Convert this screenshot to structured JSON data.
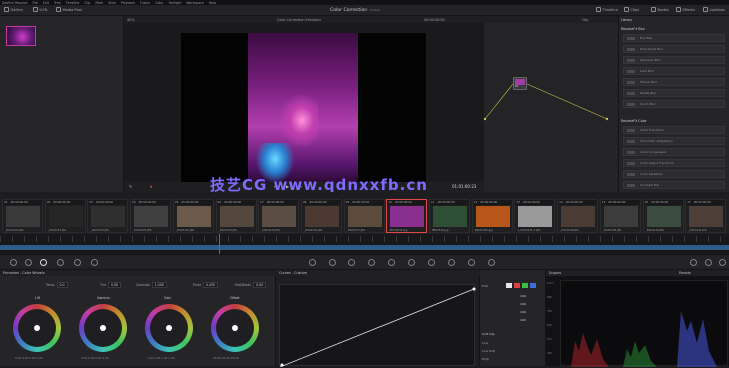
{
  "menubar": [
    "DaVinci Resolve",
    "File",
    "Edit",
    "Trim",
    "Timeline",
    "Clip",
    "Mark",
    "View",
    "Playback",
    "Fusion",
    "Color",
    "Fairlight",
    "Workspace",
    "Help"
  ],
  "toolbar": {
    "gallery": "Gallery",
    "luts": "LUTs",
    "media_pool": "Media Pool",
    "title": "Color Correction",
    "title_suffix": "Edited",
    "timeline": "Timeline",
    "clips": "Clips",
    "nodes": "Nodes",
    "effects": "Effects",
    "lightbox": "Lightbox"
  },
  "viewer": {
    "zoom": "40%",
    "timeline_name": "Color Correction Emulator",
    "timecode_top": "00:00:00:00",
    "timecode": "01:01:00:23",
    "watermark": "技艺CG www.qdnxxfb.cn"
  },
  "nodes": {
    "mode": "Clip",
    "node_label": "01"
  },
  "library": {
    "tab": "Library",
    "section1": "ResolveFX Blur",
    "blur_items": [
      "Box Blur",
      "Directional Blur",
      "Gaussian Blur",
      "Lens Blur",
      "Mosaic Blur",
      "Radial Blur",
      "Zoom Blur"
    ],
    "section2": "ResolveFX Color",
    "color_items": [
      "ACES Transform",
      "Chromatic Adaptation",
      "Color Compressor",
      "Color Space Transform",
      "Color Stabilizer",
      "Contrast Pop"
    ]
  },
  "clip_strip": [
    {
      "num": "01",
      "tc": "00:00:00:00",
      "name": "_DSC0122.JPG",
      "img": "#3a3a3a"
    },
    {
      "num": "02",
      "tc": "00:00:00:00",
      "name": "_DSC0123.JPG",
      "img": "#262626"
    },
    {
      "num": "03",
      "tc": "00:00:00:00",
      "name": "_DSC0124.JPG",
      "img": "#2f2f2f"
    },
    {
      "num": "04",
      "tc": "00:00:00:00",
      "name": "_DSC0125.JPG",
      "img": "#404040"
    },
    {
      "num": "05",
      "tc": "00:00:00:00",
      "name": "_DSC0131.JPG",
      "img": "#6b5a4a"
    },
    {
      "num": "06",
      "tc": "00:00:00:00",
      "name": "_DSC0132.JPG",
      "img": "#54483c"
    },
    {
      "num": "07",
      "tc": "00:00:00:00",
      "name": "_DSC0133.JPG",
      "img": "#5a4e42"
    },
    {
      "num": "08",
      "tc": "00:00:00:00",
      "name": "_DSC0134.JPG",
      "img": "#4b3a32"
    },
    {
      "num": "09",
      "tc": "00:00:00:00",
      "name": "_DSC0137.JPG",
      "img": "#5a4b3a"
    },
    {
      "num": "10",
      "tc": "00:00:00:00",
      "name": "06722097.jpg",
      "img": "#8a2f8d"
    },
    {
      "num": "11",
      "tc": "00:00:00:00",
      "name": "8802345.jpg",
      "img": "#2e4f34"
    },
    {
      "num": "12",
      "tc": "00:00:00:00",
      "name": "06072745.jpg",
      "img": "#b8561a"
    },
    {
      "num": "13",
      "tc": "00:00:00:00",
      "name": "1_DSC0125_1.JPG",
      "img": "#9a9a9a"
    },
    {
      "num": "14",
      "tc": "00:00:00:00",
      "name": "_DSC0138.JPG",
      "img": "#4a3c35"
    },
    {
      "num": "15",
      "tc": "00:00:00:00",
      "name": "_DSC0139.JPG",
      "img": "#3c3c3c"
    },
    {
      "num": "16",
      "tc": "00:00:00:00",
      "name": "_DSC0140.JPG",
      "img": "#3a4c3e"
    },
    {
      "num": "17",
      "tc": "00:00:00:00",
      "name": "_DSC0141.JPG",
      "img": "#4e3e38"
    }
  ],
  "wheels_panel": {
    "title": "Primaries - Color Wheels",
    "temp_label": "Temp",
    "temp": "0.0",
    "tint_label": "Tint",
    "tint": "0.00",
    "contrast_label": "Contrast",
    "contrast": "1.000",
    "pivot_label": "Pivot",
    "pivot": "0.435",
    "middetail_label": "Mid/Detail",
    "middetail": "0.00",
    "wheels": [
      {
        "label": "Lift",
        "values": "0.00 0.00 0.00 0.00"
      },
      {
        "label": "Gamma",
        "values": "0.00 0.00 0.00 0.00"
      },
      {
        "label": "Gain",
        "values": "1.00 1.00 1.00 1.00"
      },
      {
        "label": "Offset",
        "values": "25.00 25.00 25.00"
      }
    ]
  },
  "curves": {
    "title": "Curves - Custom"
  },
  "edit_panel": {
    "edit_label": "Edit",
    "values": [
      "100",
      "100",
      "100",
      "100"
    ],
    "soft_clip": "Soft Clip",
    "low": "Low",
    "low_soft": "Low Soft",
    "high": "High"
  },
  "scopes": {
    "title": "Scopes",
    "mode": "Parade",
    "ticks": [
      "1023",
      "896",
      "768",
      "640",
      "512",
      "384"
    ]
  }
}
